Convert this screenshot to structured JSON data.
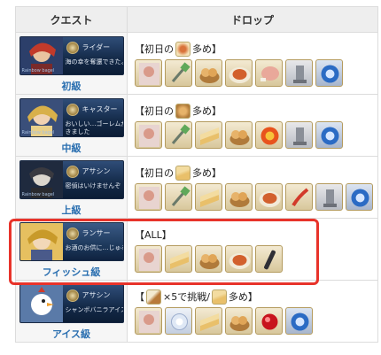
{
  "header": {
    "quest_label": "クエスト",
    "drop_label": "ドロップ"
  },
  "rows": [
    {
      "level": "初級",
      "banner": {
        "class_name": "ライダー",
        "line1": "海の幸を奪還できたよ",
        "line2": "",
        "tag": "Rainbow bagel"
      },
      "drop": {
        "prefix": "【初日の",
        "suffix": "多め】"
      }
    },
    {
      "level": "中級",
      "banner": {
        "class_name": "キャスター",
        "line1": "おいしい…ゴーレムがで",
        "line2": "きました",
        "tag": "Rainbow bagel"
      },
      "drop": {
        "prefix": "【初日の",
        "suffix": "多め】"
      }
    },
    {
      "level": "上級",
      "banner": {
        "class_name": "アサシン",
        "line1": "密偵はいけませんぞ",
        "line2": "",
        "tag": "Rainbow bagel"
      },
      "drop": {
        "prefix": "【初日の",
        "suffix": "多め】"
      }
    },
    {
      "level": "フィッシュ級",
      "banner": {
        "class_name": "ランサー",
        "line1": "お酒のお供に…じゅるり",
        "line2": "",
        "tag": ""
      },
      "drop": {
        "text": "【ALL】"
      }
    },
    {
      "level": "アイス級",
      "banner": {
        "class_name": "アサシン",
        "line1": "シャンボバニラアイス",
        "line2": "",
        "tag": ""
      },
      "drop": {
        "prefix": "【",
        "middle": "×5で挑戦/",
        "suffix": "多め】"
      }
    }
  ],
  "colors": {
    "highlight": "#e8332a",
    "level_text": "#2a6fb0"
  }
}
